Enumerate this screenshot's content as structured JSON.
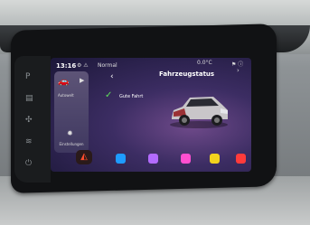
{
  "status_bar": {
    "time": "13:16",
    "icons": "⚙ ⚠",
    "mode": "Normal",
    "temperature": "0.0°C",
    "right_icons": "⚑  ⓘ"
  },
  "sidebar_widget": {
    "label": "Autowelt",
    "settings_label": "Einstellungen"
  },
  "header": {
    "title": "Fahrzeugstatus",
    "right_icon": "›"
  },
  "status": {
    "message": "Gute Fahrt"
  },
  "bottom_apps": [
    {
      "name": "hazard",
      "color": "#ff4d2d"
    },
    {
      "name": "app-blue",
      "color": "#1e9bff"
    },
    {
      "name": "app-purple",
      "color": "#b36bff"
    },
    {
      "name": "app-magenta",
      "color": "#ff4fd0"
    },
    {
      "name": "app-yellow",
      "color": "#f2d21d"
    },
    {
      "name": "app-red",
      "color": "#ff3b3b"
    }
  ]
}
